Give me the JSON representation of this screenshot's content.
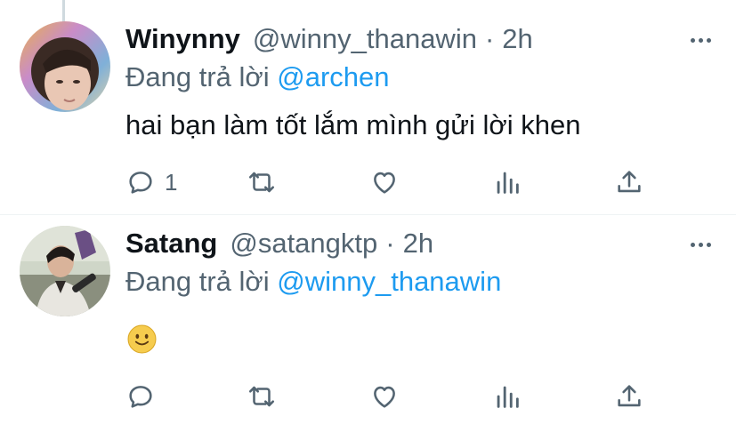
{
  "tweets": [
    {
      "name": "Winynny",
      "handle": "@winny_thanawin",
      "separator": "·",
      "time": "2h",
      "replying_prefix": "Đang trả lời",
      "replying_to": "@archen",
      "text": "hai bạn làm tốt lắm mình gửi lời khen",
      "reply_count": "1"
    },
    {
      "name": "Satang",
      "handle": "@satangktp",
      "separator": "·",
      "time": "2h",
      "replying_prefix": "Đang trả lời",
      "replying_to": "@winny_thanawin",
      "emoji": "slightly-smiling-face",
      "reply_count": ""
    }
  ],
  "icons": {
    "reply": "speech-bubble-icon",
    "retweet": "retweet-icon",
    "like": "heart-icon",
    "analytics": "bar-chart-icon",
    "share": "share-upload-icon",
    "more": "more-horizontal-icon"
  },
  "colors": {
    "link": "#1d9bf0",
    "secondary_text": "#536471",
    "primary_text": "#0f1419",
    "thread_line": "#cfd9de"
  }
}
